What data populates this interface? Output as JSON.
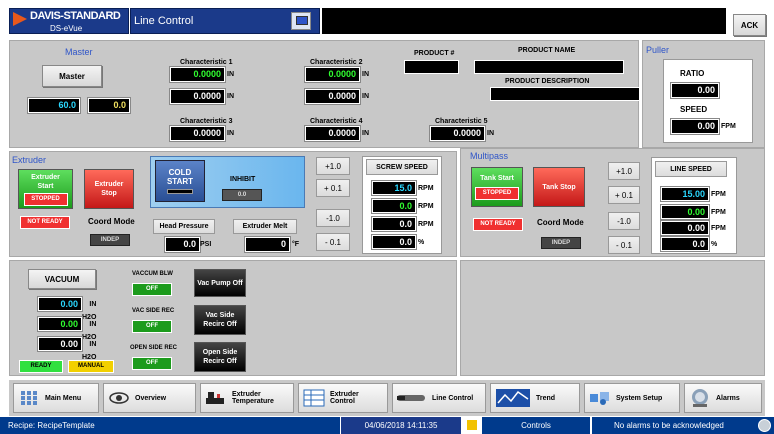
{
  "header": {
    "logo_top": "DAVIS-STANDARD",
    "logo_bottom": "DS-eVue",
    "title": "Line Control",
    "ack_label": "ACK"
  },
  "master": {
    "title": "Master",
    "button_label": "Master",
    "value_left": "60.0",
    "value_right": "0.0"
  },
  "characteristics": [
    {
      "label": "Characteristic 1",
      "value1": "0.0000",
      "unit1": "IN",
      "value2": "0.0000",
      "unit2": "IN"
    },
    {
      "label": "Characteristic 2",
      "value1": "0.0000",
      "unit1": "IN",
      "value2": "0.0000",
      "unit2": "IN"
    },
    {
      "label": "Characteristic 3",
      "value": "0.0000",
      "unit": "IN"
    },
    {
      "label": "Characteristic 4",
      "value": "0.0000",
      "unit": "IN"
    },
    {
      "label": "Characteristic 5",
      "value": "0.0000",
      "unit": "IN"
    }
  ],
  "product": {
    "number_label": "PRODUCT #",
    "name_label": "PRODUCT NAME",
    "description_label": "PRODUCT DESCRIPTION"
  },
  "puller": {
    "title": "Puller",
    "ratio_label": "RATIO",
    "ratio_value": "0.00",
    "speed_label": "SPEED",
    "speed_value": "0.00",
    "speed_unit": "FPM"
  },
  "extruder": {
    "title": "Extruder",
    "start_label": "Extruder Start",
    "start_status": "STOPPED",
    "stop_label": "Extruder Stop",
    "not_ready": "NOT READY",
    "coord_mode_label": "Coord Mode",
    "coord_mode_value": "INDEP",
    "cold_start_label": "COLD START",
    "inhibit_label": "INHIBIT",
    "inhibit_value": "0.0",
    "head_pressure_label": "Head Pressure",
    "head_pressure_value": "0.0",
    "head_pressure_unit": "PSI",
    "melt_label": "Extruder Melt",
    "melt_value": "0",
    "melt_unit": "°F",
    "inc1": "+1.0",
    "inc01": "+ 0.1",
    "dec1": "-1.0",
    "dec01": "- 0.1",
    "screw_speed_label": "SCREW SPEED",
    "screw_values": [
      {
        "value": "15.0",
        "unit": "RPM"
      },
      {
        "value": "0.0",
        "unit": "RPM"
      },
      {
        "value": "0.0",
        "unit": "RPM"
      },
      {
        "value": "0.0",
        "unit": "%"
      }
    ]
  },
  "multipass": {
    "title": "Multipass",
    "tank_start_label": "Tank Start",
    "tank_status": "STOPPED",
    "tank_stop_label": "Tank Stop",
    "not_ready": "NOT READY",
    "coord_mode_label": "Coord Mode",
    "coord_mode_value": "INDEP",
    "inc1": "+1.0",
    "inc01": "+ 0.1",
    "dec1": "-1.0",
    "dec01": "- 0.1",
    "line_speed_label": "LINE SPEED",
    "line_values": [
      {
        "value": "15.00",
        "unit": "FPM"
      },
      {
        "value": "0.00",
        "unit": "FPM"
      },
      {
        "value": "0.00",
        "unit": "FPM"
      },
      {
        "value": "0.0",
        "unit": "%"
      }
    ]
  },
  "vacuum": {
    "title": "VACUUM",
    "values": [
      {
        "value": "0.00",
        "unit": "IN H2O"
      },
      {
        "value": "0.00",
        "unit": "IN H2O"
      },
      {
        "value": "0.00",
        "unit": "IN H2O"
      }
    ],
    "ready": "READY",
    "manual": "MANUAL",
    "blw_label": "VACCUM BLW",
    "blw_state": "OFF",
    "pump_button": "Vac Pump Off",
    "side_rec_label": "VAC SIDE REC",
    "side_rec_state": "OFF",
    "side_recirc_button": "Vac Side Recirc Off",
    "open_side_label": "OPEN SIDE REC",
    "open_side_state": "OFF",
    "open_recirc_button": "Open Side Recirc Off"
  },
  "nav": [
    {
      "label": "Main Menu",
      "icon": "menu-grid-icon"
    },
    {
      "label": "Overview",
      "icon": "eye-icon"
    },
    {
      "label": "Extruder Temperature",
      "icon": "extruder-icon"
    },
    {
      "label": "Extruder Control",
      "icon": "table-icon"
    },
    {
      "label": "Line Control",
      "icon": "line-icon"
    },
    {
      "label": "Trend",
      "icon": "trend-icon"
    },
    {
      "label": "System Setup",
      "icon": "setup-icon"
    },
    {
      "label": "Alarms",
      "icon": "alarm-icon"
    }
  ],
  "statusbar": {
    "recipe_label": "Recipe:",
    "recipe_value": "RecipeTemplate",
    "datetime": "04/06/2018 14:11:35",
    "screen": "Controls",
    "alarms": "No alarms to be acknowledged"
  },
  "colors": {
    "accent": "#2f55c8",
    "status_bar": "#003a8c",
    "panel": "#c8c8c8"
  }
}
